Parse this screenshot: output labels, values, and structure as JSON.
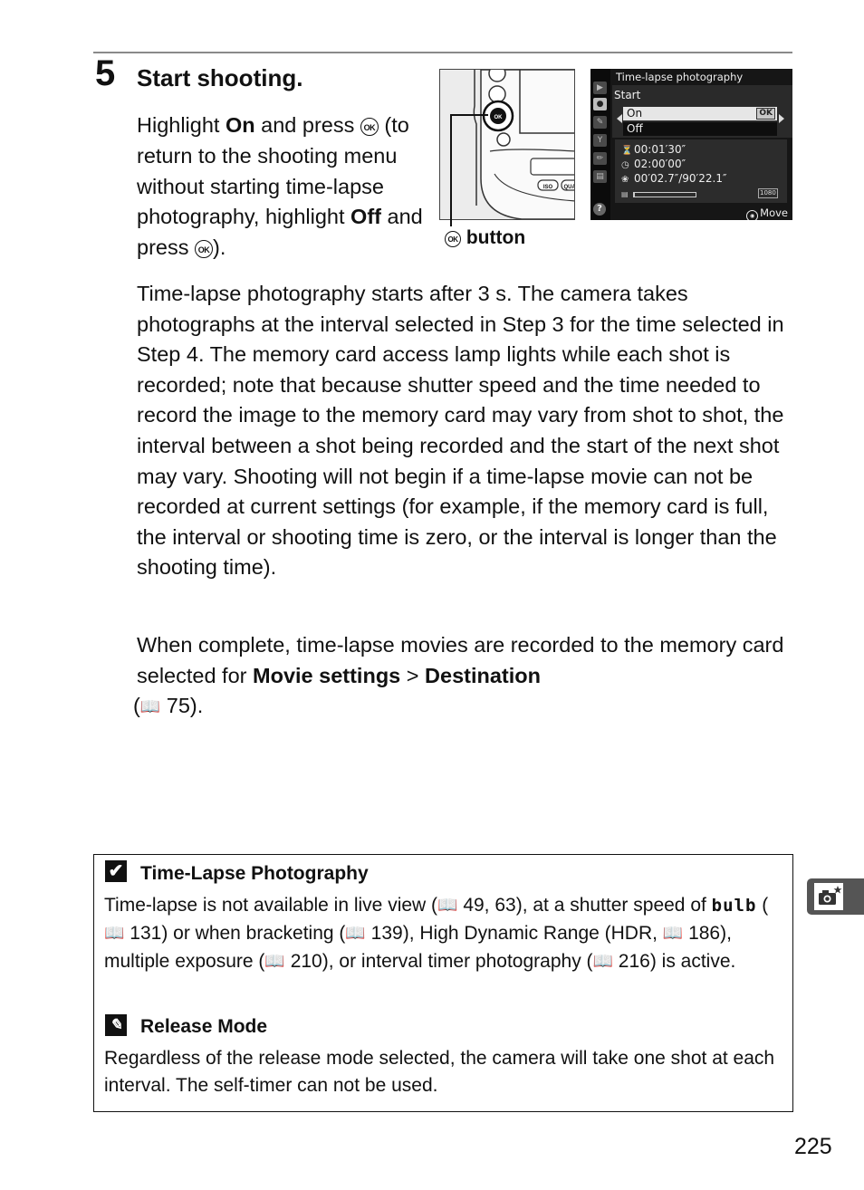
{
  "step": {
    "number": "5",
    "title": "Start shooting.",
    "instructions": {
      "part1": "Highlight ",
      "on_label": "On",
      "part2": " and press ",
      "part3": " (to return to the shooting menu without starting time-lapse photography, highlight ",
      "off_label": "Off",
      "part4": " and press ",
      "part5": ")."
    },
    "ok_glyph": "OK"
  },
  "illustration": {
    "camera_callout_label": "button",
    "camera_button_labels": [
      "OK",
      "ISO",
      "QUAL"
    ]
  },
  "camera_screen": {
    "title": "Time-lapse photography",
    "menu_label": "Start",
    "options": [
      {
        "label": "On",
        "selected": true,
        "badge": "OK"
      },
      {
        "label": "Off",
        "selected": false
      }
    ],
    "sidebar_tabs": [
      "playback-menu",
      "shooting-menu",
      "custom-settings",
      "setup-menu",
      "retouch-menu",
      "my-menu"
    ],
    "active_tab": "shooting-menu",
    "help_label": "?",
    "interval": "00:01′30″",
    "shooting_time": "02:00′00″",
    "movie_length": "00′02.7″/90′22.1″",
    "progress": 0.02,
    "movie_badge": "1080",
    "footer_hint": "Move"
  },
  "paragraphs": {
    "p1": "Time-lapse photography starts after 3 s.  The camera takes photographs at the interval selected in Step 3 for the time selected in Step 4.  The memory card access lamp lights while each shot is recorded; note that because shutter speed and the time needed to record the image to the memory card may vary from shot to shot, the interval between a shot being recorded and the start of the next shot may vary.  Shooting will not begin if a time-lapse movie can not be recorded at current settings (for example, if the memory card is full, the interval or shooting time is zero, or the interval is longer than the shooting time).",
    "p2": {
      "a": "When complete, time-lapse movies are recorded to the memory card selected for ",
      "b1": "Movie settings",
      "sep": " > ",
      "b2": "Destination",
      "c_open": " (",
      "page_ref": "75",
      "c_close": ")."
    }
  },
  "notes": [
    {
      "icon": "caution-check",
      "title": "Time-Lapse Photography",
      "body": {
        "t1": "Time-lapse is not available in live view (",
        "r1": "49, 63",
        "t2": "), at a shutter speed of ",
        "bulb": "bulb",
        "t3": " (",
        "r2": "131",
        "t4": ") or when bracketing (",
        "r3": "139",
        "t5": "), High Dynamic Range (HDR, ",
        "r4": "186",
        "t6": "), multiple exposure (",
        "r5": "210",
        "t7": "), or interval timer photography (",
        "r6": "216",
        "t8": ") is active."
      }
    },
    {
      "icon": "pencil-note",
      "title": "Release Mode",
      "body": "Regardless of the release mode selected, the camera will take one shot at each interval.  The self-timer can not be used."
    }
  ],
  "book_icon": "🕮",
  "side_tab": {
    "icon": "camera-star-icon",
    "color": "#555555"
  },
  "page_number": "225"
}
